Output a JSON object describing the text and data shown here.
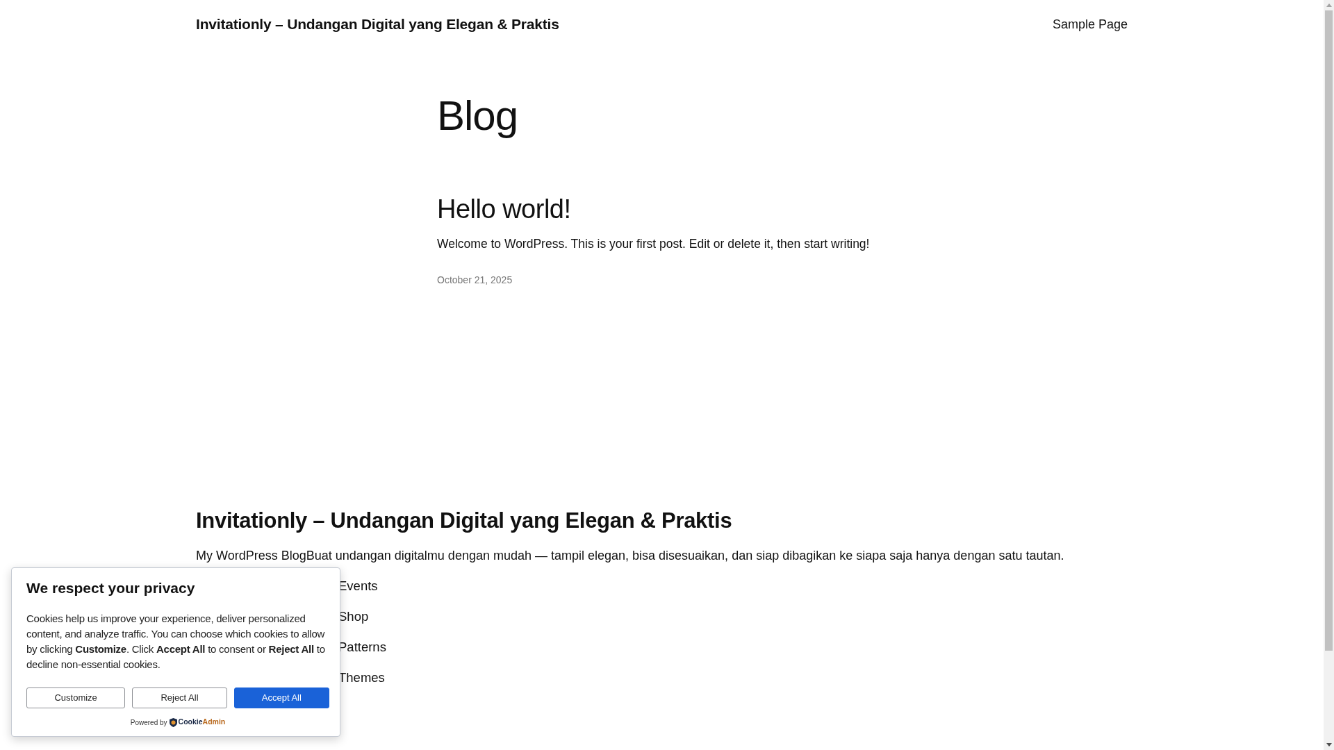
{
  "header": {
    "site_title": "Invitationly – Undangan Digital yang Elegan & Praktis",
    "nav": [
      {
        "label": "Sample Page"
      }
    ]
  },
  "page": {
    "title": "Blog",
    "posts": [
      {
        "title": "Hello world!",
        "excerpt": "Welcome to WordPress. This is your first post. Edit or delete it, then start writing!",
        "date": "October 21, 2025"
      }
    ]
  },
  "footer": {
    "site_title": "Invitationly – Undangan Digital yang Elegan & Praktis",
    "description": "My WordPress BlogBuat undangan digitalmu dengan mudah — tampil elegan, bisa disesuaikan, dan siap dibagikan ke siapa saja hanya dengan satu tautan.",
    "links": [
      "Events",
      "Shop",
      "Patterns",
      "Themes"
    ]
  },
  "cookie_banner": {
    "title": "We respect your privacy",
    "message": "Cookies help us improve your experience, deliver personalized content, and analyze traffic. You can choose which cookies to allow by clicking **Customize**. Click **Accept All** to consent or **Reject All** to decline non-essential cookies.",
    "buttons": [
      {
        "label": "Customize",
        "kind": "outline"
      },
      {
        "label": "Reject All",
        "kind": "outline"
      },
      {
        "label": "Accept All",
        "kind": "primary"
      }
    ],
    "powered_by": {
      "label": "Powered by",
      "brand": [
        {
          "text": "Cookie",
          "kind": "base"
        },
        {
          "text": "Admin",
          "kind": "accent"
        }
      ]
    }
  }
}
